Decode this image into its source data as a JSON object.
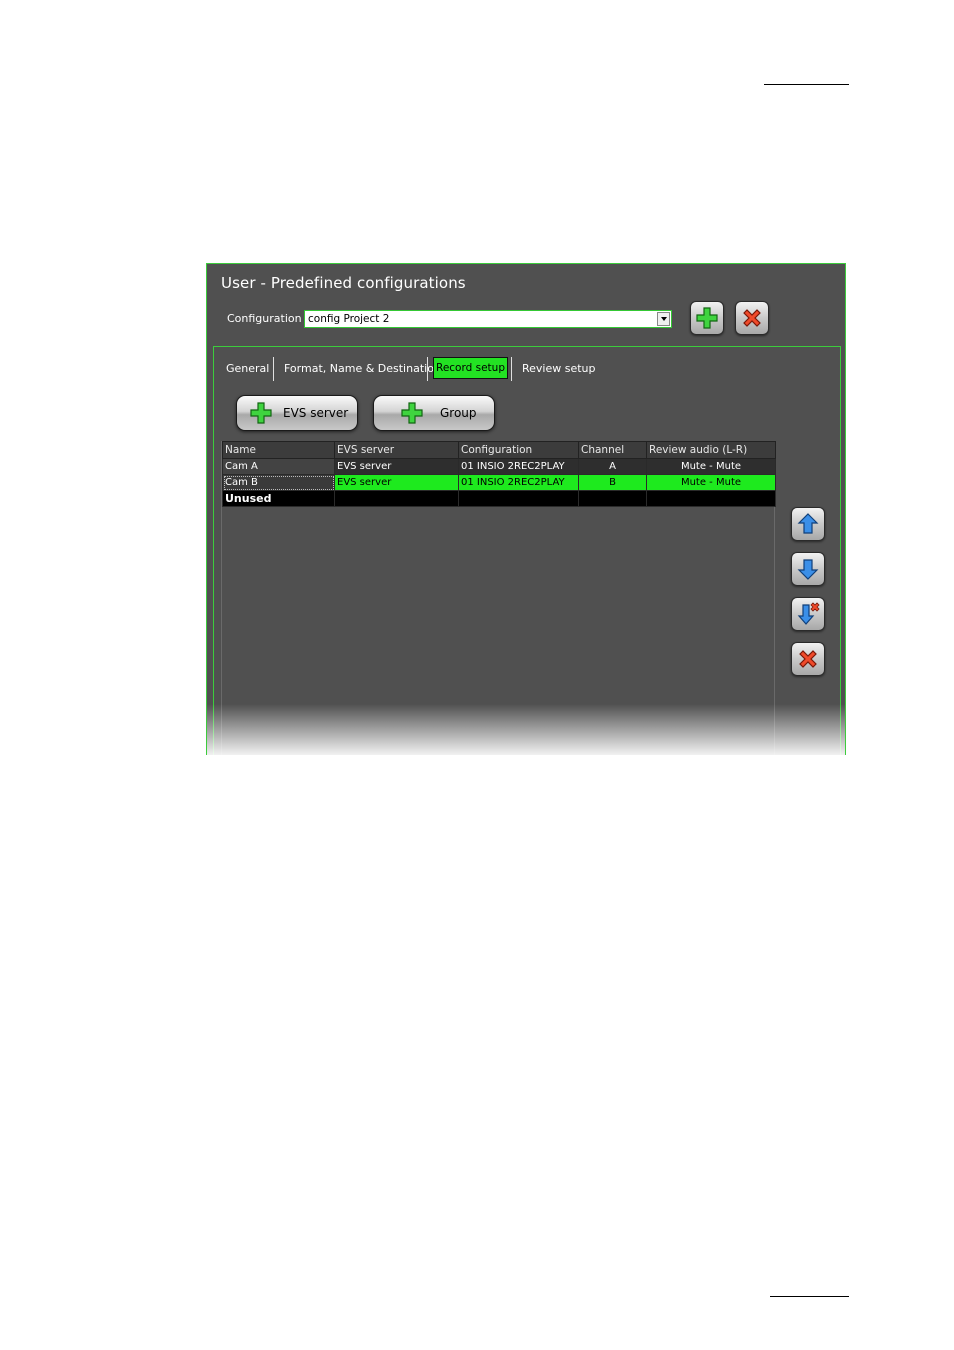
{
  "window": {
    "title": "User - Predefined configurations",
    "configuration_label": "Configuration :",
    "configuration_value": "config Project 2"
  },
  "tabs": [
    {
      "label": "General",
      "selected": false
    },
    {
      "label": "Format, Name & Destination",
      "selected": false
    },
    {
      "label": "Record setup",
      "selected": true
    },
    {
      "label": "Review setup",
      "selected": false
    }
  ],
  "buttons": {
    "add_evs_server": "EVS server",
    "add_group": "Group"
  },
  "table": {
    "columns": [
      "Name",
      "EVS server",
      "Configuration",
      "Channel",
      "Review audio (L-R)"
    ],
    "rows": [
      {
        "name": "Cam A",
        "server": "EVS server",
        "configuration": "01 INSIO 2REC2PLAY",
        "channel": "A",
        "audio": "Mute - Mute"
      },
      {
        "name": "Cam B",
        "server": "EVS server",
        "configuration": "01 INSIO 2REC2PLAY",
        "channel": "B",
        "audio": "Mute - Mute"
      },
      {
        "name": "Unused",
        "server": "",
        "configuration": "",
        "channel": "",
        "audio": ""
      }
    ]
  },
  "colors": {
    "accent_green": "#23e223",
    "window_bg": "#505050",
    "border_green": "#3ccc3c"
  },
  "icons": [
    "plus-icon",
    "delete-x-icon",
    "arrow-up-icon",
    "arrow-down-icon",
    "arrow-down-remove-icon"
  ]
}
